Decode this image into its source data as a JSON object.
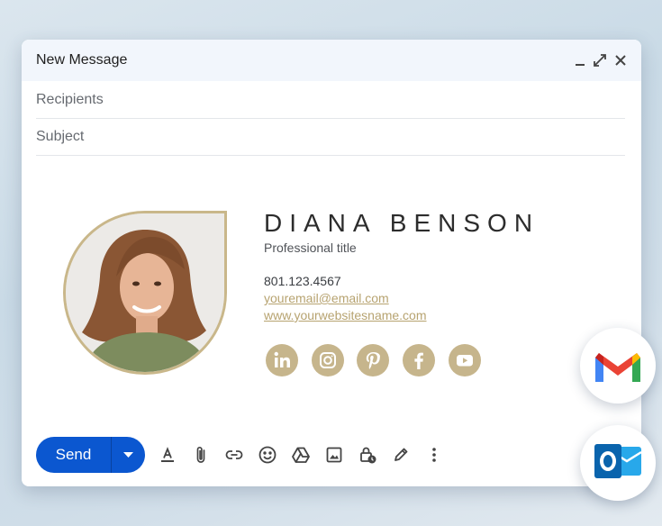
{
  "window": {
    "title": "New Message",
    "buttons": [
      "minimize-icon",
      "expand-icon",
      "close-icon"
    ]
  },
  "fields": {
    "recipients_label": "Recipients",
    "subject_label": "Subject"
  },
  "signature": {
    "name": "DIANA BENSON",
    "title": "Professional title",
    "phone": "801.123.4567",
    "email": "youremail@email.com",
    "website": "www.yourwebsitesname.com",
    "accent_color": "#c9b78a",
    "social_icons": [
      "linkedin-icon",
      "instagram-icon",
      "pinterest-icon",
      "facebook-icon",
      "youtube-icon"
    ]
  },
  "toolbar": {
    "send_label": "Send",
    "send_color": "#0b57d0",
    "tools": [
      "text-format-icon",
      "attachment-icon",
      "link-icon",
      "emoji-icon",
      "drive-icon",
      "image-icon",
      "lock-clock-icon",
      "pen-icon",
      "more-vert-icon"
    ]
  },
  "apps": [
    "gmail-icon",
    "outlook-icon"
  ]
}
